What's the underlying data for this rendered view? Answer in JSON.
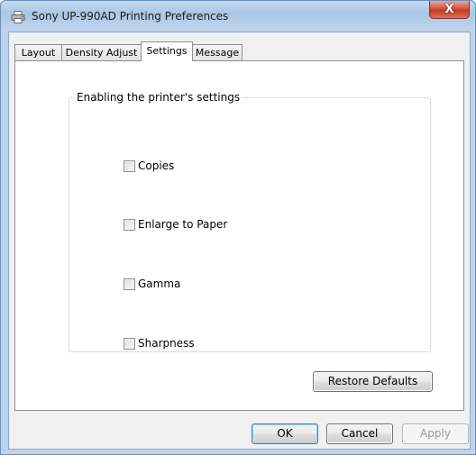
{
  "window": {
    "title": "Sony UP-990AD Printing Preferences",
    "close_glyph": "X",
    "icon": "printer-icon"
  },
  "tabs": [
    {
      "label": "Layout",
      "active": false
    },
    {
      "label": "Density Adjust",
      "active": false
    },
    {
      "label": "Settings",
      "active": true
    },
    {
      "label": "Message",
      "active": false
    }
  ],
  "settings": {
    "group_title": "Enabling the printer's settings",
    "checkboxes": [
      {
        "label": "Copies",
        "checked": false
      },
      {
        "label": "Enlarge to Paper",
        "checked": false
      },
      {
        "label": "Gamma",
        "checked": false
      },
      {
        "label": "Sharpness",
        "checked": false
      }
    ],
    "restore_defaults_label": "Restore Defaults"
  },
  "footer": {
    "ok_label": "OK",
    "cancel_label": "Cancel",
    "apply_label": "Apply",
    "apply_enabled": false
  }
}
